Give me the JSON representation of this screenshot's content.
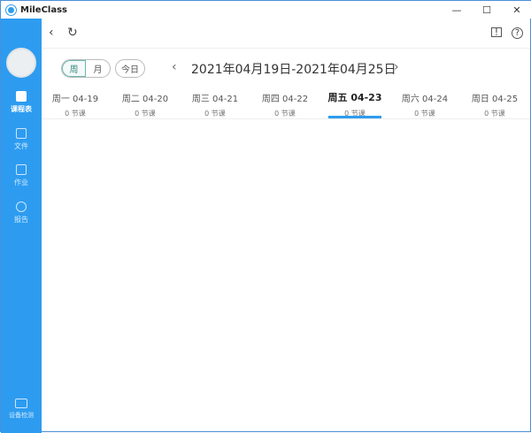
{
  "app": {
    "title": "MileClass"
  },
  "window": {
    "minimize": "—",
    "maximize": "☐",
    "close": "✕"
  },
  "sidebar": {
    "items": [
      {
        "label": "课程表"
      },
      {
        "label": "文件"
      },
      {
        "label": "作业"
      },
      {
        "label": "报告"
      }
    ],
    "bottom": "设备检测"
  },
  "view": {
    "week": "周",
    "month": "月",
    "today": "今日",
    "range": "2021年04月19日-2021年04月25日",
    "prev": "‹",
    "next": "›"
  },
  "days": [
    {
      "label": "周一  04-19",
      "count": "0 节课"
    },
    {
      "label": "周二  04-20",
      "count": "0 节课"
    },
    {
      "label": "周三  04-21",
      "count": "0 节课"
    },
    {
      "label": "周四  04-22",
      "count": "0 节课"
    },
    {
      "label": "周五  04-23",
      "count": "0 节课",
      "selected": true
    },
    {
      "label": "周六  04-24",
      "count": "0 节课"
    },
    {
      "label": "周日  04-25",
      "count": "0 节课"
    }
  ]
}
